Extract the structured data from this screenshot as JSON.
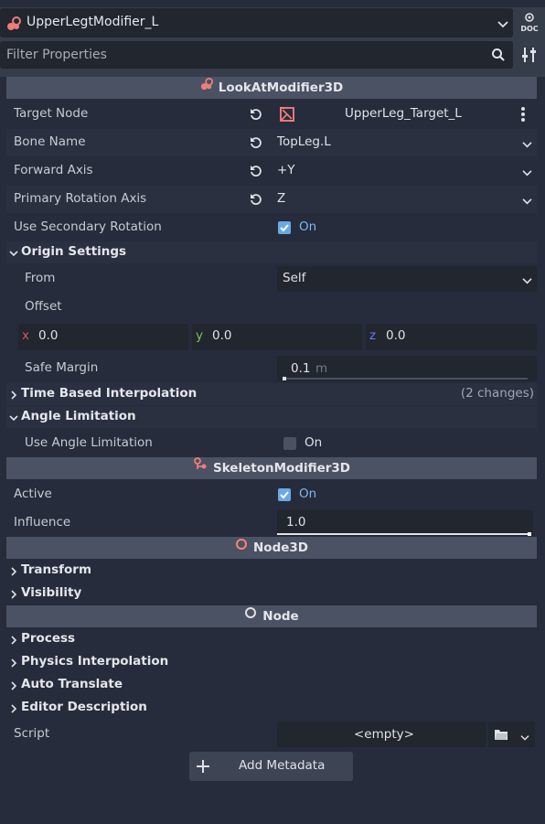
{
  "header": {
    "node_name": "UpperLegtModifier_L",
    "filter_placeholder": "Filter Properties",
    "doc_label": "DOC"
  },
  "sections": {
    "lookat": {
      "title": "LookAtModifier3D",
      "target_node_label": "Target Node",
      "target_node_value": "UpperLeg_Target_L",
      "bone_name_label": "Bone Name",
      "bone_name_value": "TopLeg.L",
      "forward_axis_label": "Forward Axis",
      "forward_axis_value": "+Y",
      "primary_rotation_axis_label": "Primary Rotation Axis",
      "primary_rotation_axis_value": "Z",
      "use_secondary_rotation_label": "Use Secondary Rotation",
      "use_secondary_rotation_value": "On",
      "origin_settings_label": "Origin Settings",
      "from_label": "From",
      "from_value": "Self",
      "offset_label": "Offset",
      "offset_x_label": "x",
      "offset_x": "0.0",
      "offset_y_label": "y",
      "offset_y": "0.0",
      "offset_z_label": "z",
      "offset_z": "0.0",
      "safe_margin_label": "Safe Margin",
      "safe_margin_value": "0.1",
      "safe_margin_unit": "m",
      "time_based_interpolation_label": "Time Based Interpolation",
      "time_based_interpolation_changes": "(2 changes)",
      "angle_limitation_label": "Angle Limitation",
      "use_angle_limitation_label": "Use Angle Limitation",
      "use_angle_limitation_value": "On"
    },
    "skeleton": {
      "title": "SkeletonModifier3D",
      "active_label": "Active",
      "active_value": "On",
      "influence_label": "Influence",
      "influence_value": "1.0"
    },
    "node3d": {
      "title": "Node3D",
      "transform_label": "Transform",
      "visibility_label": "Visibility"
    },
    "node": {
      "title": "Node",
      "process_label": "Process",
      "physics_interpolation_label": "Physics Interpolation",
      "auto_translate_label": "Auto Translate",
      "editor_description_label": "Editor Description",
      "script_label": "Script",
      "script_value": "<empty>",
      "add_metadata_label": "Add Metadata"
    }
  },
  "colors": {
    "accent": "#77b9f2",
    "panel": "#262c3b",
    "category": "#4b5263",
    "node3d_icon": "#fc7f7f",
    "axis_x": "#c95e5e",
    "axis_y": "#7ec25a",
    "axis_z": "#6a7df0"
  },
  "icons": {
    "node_icon": "lookat-modifier-icon",
    "target_icon": "target-node-icon",
    "revert_icon": "revert-icon",
    "search_icon": "search-icon",
    "tools_icon": "property-tools-icon"
  }
}
